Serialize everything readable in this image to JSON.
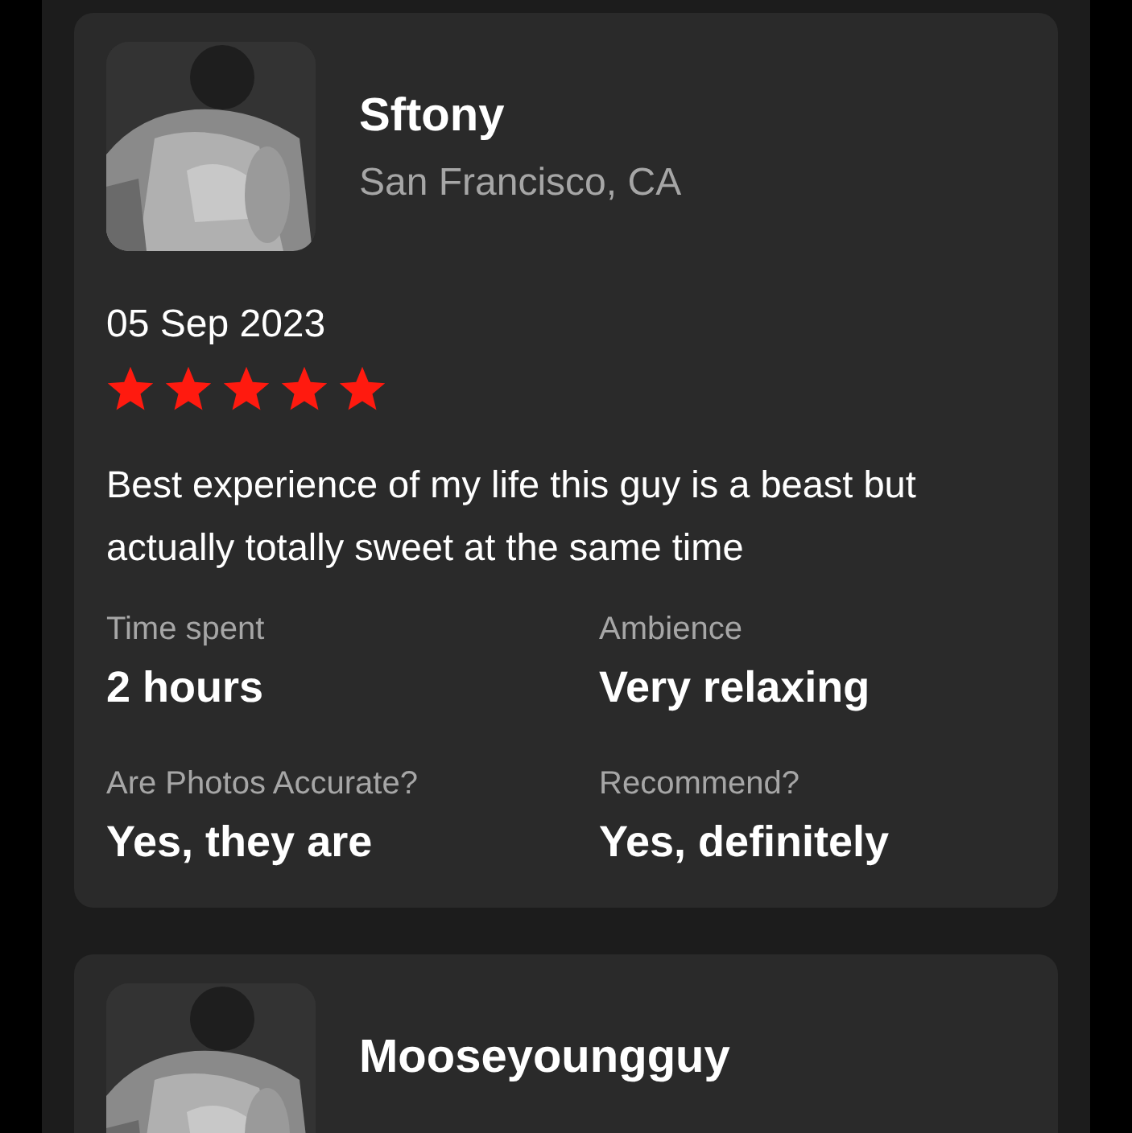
{
  "reviews": [
    {
      "name": "Sftony",
      "location": "San Francisco, CA",
      "date": "05 Sep 2023",
      "stars": 5,
      "text": "Best experience of my life this guy is a beast but actually totally sweet at the same time",
      "details": [
        {
          "label": "Time spent",
          "value": "2 hours"
        },
        {
          "label": "Ambience",
          "value": "Very relaxing"
        },
        {
          "label": "Are Photos Accurate?",
          "value": "Yes, they are"
        },
        {
          "label": "Recommend?",
          "value": "Yes, definitely"
        }
      ]
    },
    {
      "name": "Mooseyoungguy"
    }
  ]
}
